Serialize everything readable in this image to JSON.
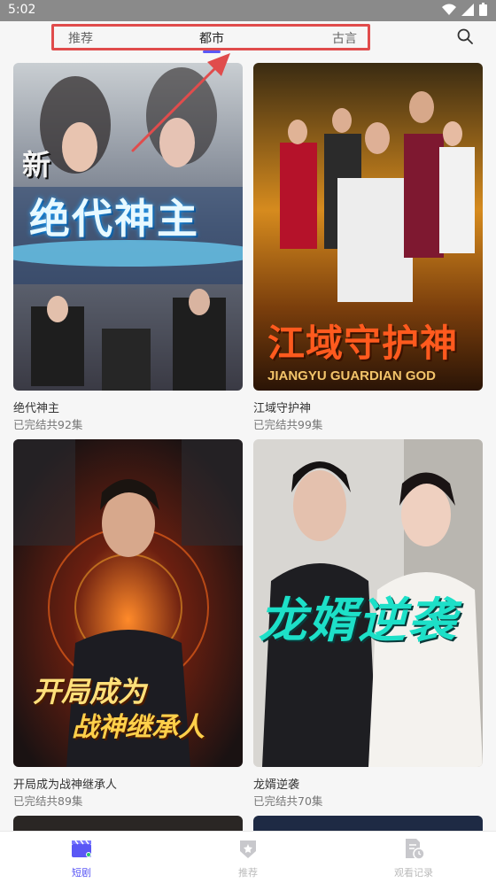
{
  "status": {
    "time": "5:02"
  },
  "tabs": [
    {
      "label": "推荐"
    },
    {
      "label": "都市"
    },
    {
      "label": "古言"
    }
  ],
  "cards": [
    {
      "title": "绝代神主",
      "subtitle": "已完结共92集",
      "poster_text": "绝代神主",
      "poster_sub": "新"
    },
    {
      "title": "江域守护神",
      "subtitle": "已完结共99集",
      "poster_text": "江域守护神",
      "poster_sub": "JIANGYU GUARDIAN GOD"
    },
    {
      "title": "开局成为战神继承人",
      "subtitle": "已完结共89集",
      "poster_text": "开局成为",
      "poster_text2": "战神继承人"
    },
    {
      "title": "龙婿逆袭",
      "subtitle": "已完结共70集",
      "poster_text": "龙婿逆袭"
    }
  ],
  "bottom_nav": [
    {
      "label": "短剧",
      "icon": "clapperboard-icon",
      "active": true
    },
    {
      "label": "推荐",
      "icon": "star-shield-icon",
      "active": false
    },
    {
      "label": "观看记录",
      "icon": "history-doc-icon",
      "active": false
    }
  ],
  "colors": {
    "accent": "#5a57f5",
    "highlight": "#e04c4c"
  }
}
